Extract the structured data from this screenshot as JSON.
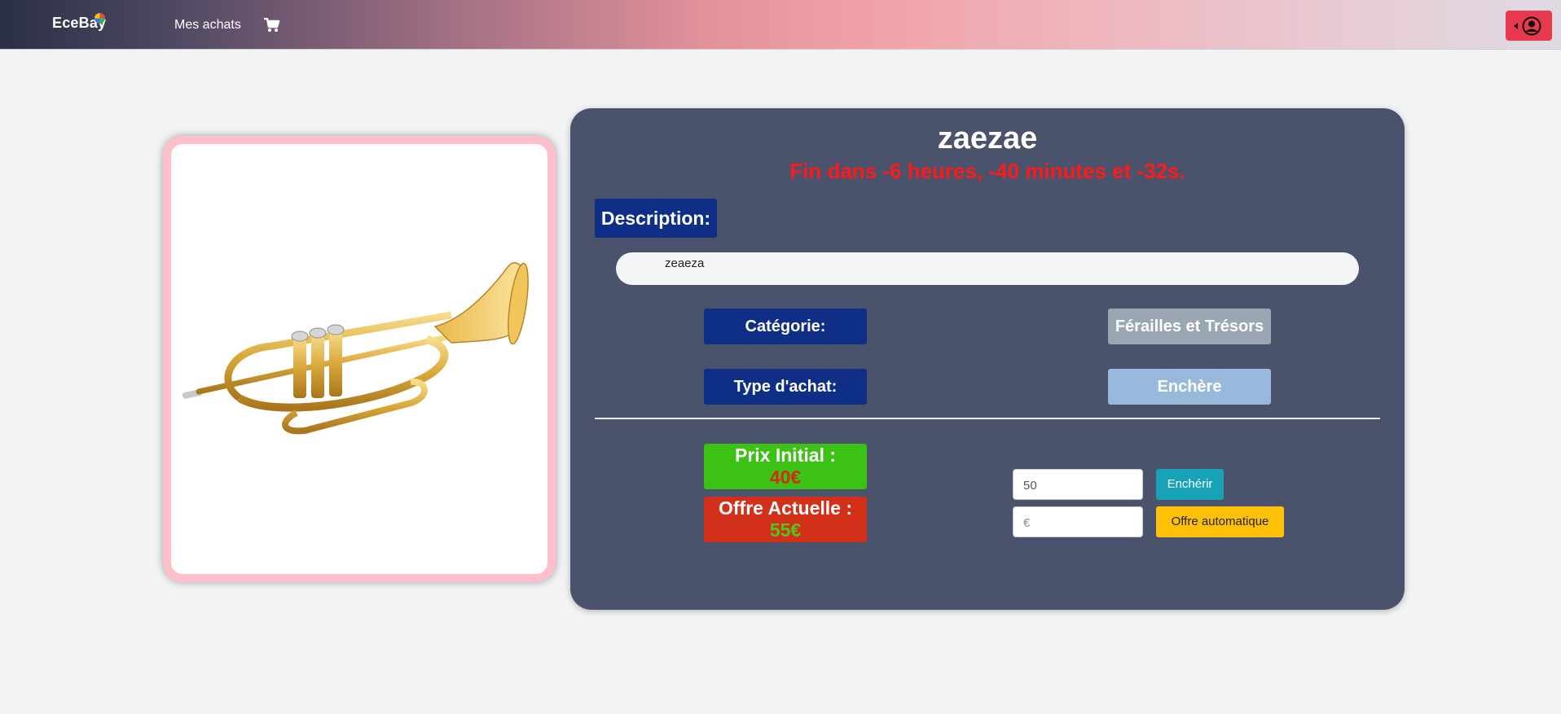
{
  "navbar": {
    "brand": "EceBay",
    "links": {
      "purchases": "Mes achats"
    },
    "icons": {
      "cart": "cart-icon",
      "user": "user-circle-icon"
    },
    "gradient_colors": [
      "#2b3045",
      "#f0a0a6",
      "#dedbe3"
    ]
  },
  "product": {
    "image_alt": "trumpet",
    "title": "zaezae",
    "countdown": "Fin dans -6 heures, -40 minutes et -32s.",
    "description_label": "Description:",
    "description": "zeaeza",
    "category_label": "Catégorie:",
    "category_value": "Férailles et Trésors",
    "type_label": "Type d'achat:",
    "type_value": "Enchère"
  },
  "pricing": {
    "initial_label": "Prix Initial :",
    "initial_value": "40€",
    "current_label": "Offre Actuelle :",
    "current_value": "55€"
  },
  "bidding": {
    "bid_input_value": "50",
    "bid_button": "Enchérir",
    "auto_input_placeholder": "€",
    "auto_button": "Offre automatique"
  },
  "colors": {
    "page_bg": "#f2f3f5",
    "panel_bg": "#4a536b",
    "label_bg": "#0f2f86",
    "image_border": "#ffc0cb",
    "countdown": "#ff1a1a",
    "initial_bg": "#3cc115",
    "current_bg": "#d3301a",
    "bid_button": "#17a2b8",
    "auto_button": "#ffc107",
    "user_button": "#e8394f"
  }
}
